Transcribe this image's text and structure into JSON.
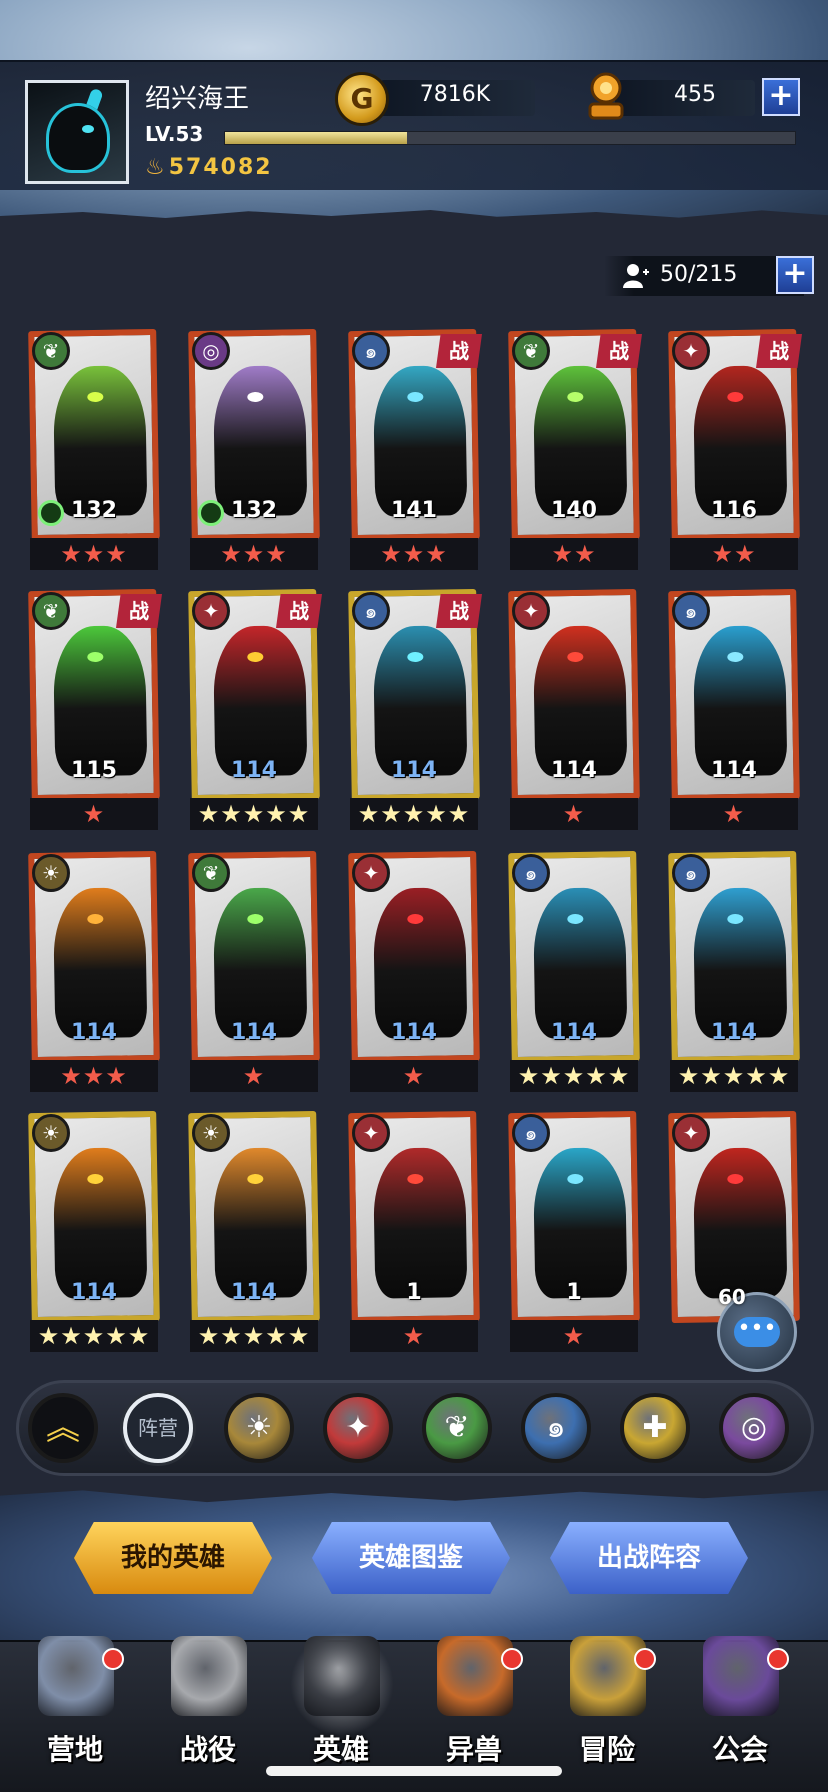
{
  "header": {
    "username": "绍兴海王",
    "level": "LV.53",
    "xp_fraction": 0.32,
    "power": "574082",
    "gold": "7816K",
    "gold_icon": "G",
    "gems": "455",
    "plus": "+"
  },
  "roster": {
    "capacity": "50/215",
    "plus": "+"
  },
  "heroes": [
    {
      "level": "132",
      "stars": "★★★",
      "star_style": "red",
      "faction_icon": "leaf-icon",
      "faction_color": "#3f7a3a",
      "battle": false,
      "clock": true,
      "level_style": "white",
      "frame": "red",
      "figure": "#79c23b",
      "eye": "#d8ff4a"
    },
    {
      "level": "132",
      "stars": "★★★",
      "star_style": "red",
      "faction_icon": "void-icon",
      "faction_color": "#6a3a86",
      "battle": false,
      "clock": true,
      "level_style": "white",
      "frame": "red",
      "figure": "#a07cc8",
      "eye": "#ffffff"
    },
    {
      "level": "141",
      "stars": "★★★",
      "star_style": "red",
      "faction_icon": "wave-icon",
      "faction_color": "#3a5f9a",
      "battle": true,
      "clock": false,
      "level_style": "white",
      "frame": "red",
      "figure": "#34a8c4",
      "eye": "#7ae6ff"
    },
    {
      "level": "140",
      "stars": "★★",
      "star_style": "red",
      "faction_icon": "leaf-icon",
      "faction_color": "#3f7a3a",
      "battle": true,
      "clock": false,
      "level_style": "white",
      "frame": "red",
      "figure": "#5ec23b",
      "eye": "#b6ff6a"
    },
    {
      "level": "116",
      "stars": "★★",
      "star_style": "red",
      "faction_icon": "flame-icon",
      "faction_color": "#9a2f35",
      "battle": true,
      "clock": false,
      "level_style": "white",
      "frame": "red",
      "figure": "#b2261f",
      "eye": "#ff3a3a"
    },
    {
      "level": "115",
      "stars": "★",
      "star_style": "red",
      "faction_icon": "leaf-icon",
      "faction_color": "#3f7a3a",
      "battle": true,
      "clock": false,
      "level_style": "white",
      "frame": "red",
      "figure": "#4cc83b",
      "eye": "#9dff6a"
    },
    {
      "level": "114",
      "stars": "★★★★★",
      "star_style": "gold",
      "faction_icon": "flame-icon",
      "faction_color": "#9a2f35",
      "battle": true,
      "clock": false,
      "level_style": "blue",
      "frame": "gold",
      "figure": "#c4262a",
      "eye": "#ffcc33"
    },
    {
      "level": "114",
      "stars": "★★★★★",
      "star_style": "gold",
      "faction_icon": "wave-icon",
      "faction_color": "#3a5f9a",
      "battle": true,
      "clock": false,
      "level_style": "blue",
      "frame": "gold",
      "figure": "#2b8fb0",
      "eye": "#6ff0ff"
    },
    {
      "level": "114",
      "stars": "★",
      "star_style": "red",
      "faction_icon": "flame-icon",
      "faction_color": "#9a2f35",
      "battle": false,
      "clock": false,
      "level_style": "white",
      "frame": "red",
      "figure": "#d0301f",
      "eye": "#ff4a3a"
    },
    {
      "level": "114",
      "stars": "★",
      "star_style": "red",
      "faction_icon": "wave-icon",
      "faction_color": "#3a5f9a",
      "battle": false,
      "clock": false,
      "level_style": "white",
      "frame": "red",
      "figure": "#2a9fcf",
      "eye": "#8ae8ff"
    },
    {
      "level": "114",
      "stars": "★★★",
      "star_style": "red",
      "faction_icon": "sun-icon",
      "faction_color": "#6b5a2a",
      "battle": false,
      "clock": false,
      "level_style": "blue",
      "frame": "red",
      "figure": "#e07d1c",
      "eye": "#ffb23a"
    },
    {
      "level": "114",
      "stars": "★",
      "star_style": "red",
      "faction_icon": "leaf-icon",
      "faction_color": "#3f7a3a",
      "battle": false,
      "clock": false,
      "level_style": "blue",
      "frame": "red",
      "figure": "#4aa84a",
      "eye": "#9dff6a"
    },
    {
      "level": "114",
      "stars": "★",
      "star_style": "red",
      "faction_icon": "flame-icon",
      "faction_color": "#9a2f35",
      "battle": false,
      "clock": false,
      "level_style": "blue",
      "frame": "red",
      "figure": "#9a1f24",
      "eye": "#ff3a3a"
    },
    {
      "level": "114",
      "stars": "★★★★★",
      "star_style": "gold",
      "faction_icon": "wave-icon",
      "faction_color": "#3a5f9a",
      "battle": false,
      "clock": false,
      "level_style": "blue",
      "frame": "gold",
      "figure": "#2a8fb6",
      "eye": "#7ae6ff"
    },
    {
      "level": "114",
      "stars": "★★★★★",
      "star_style": "gold",
      "faction_icon": "wave-icon",
      "faction_color": "#3a5f9a",
      "battle": false,
      "clock": false,
      "level_style": "blue",
      "frame": "gold",
      "figure": "#2f9fd0",
      "eye": "#7ae6ff"
    },
    {
      "level": "114",
      "stars": "★★★★★",
      "star_style": "gold",
      "faction_icon": "sun-icon",
      "faction_color": "#6b5a2a",
      "battle": false,
      "clock": false,
      "level_style": "blue",
      "frame": "gold",
      "figure": "#e07d1c",
      "eye": "#ffd23a"
    },
    {
      "level": "114",
      "stars": "★★★★★",
      "star_style": "gold",
      "faction_icon": "sun-icon",
      "faction_color": "#6b5a2a",
      "battle": false,
      "clock": false,
      "level_style": "blue",
      "frame": "gold",
      "figure": "#e0892c",
      "eye": "#ffd23a"
    },
    {
      "level": "1",
      "stars": "★",
      "star_style": "red",
      "faction_icon": "flame-icon",
      "faction_color": "#9a2f35",
      "battle": false,
      "clock": false,
      "level_style": "white",
      "frame": "red",
      "figure": "#b02a2a",
      "eye": "#ff4a3a"
    },
    {
      "level": "1",
      "stars": "★",
      "star_style": "red",
      "faction_icon": "wave-icon",
      "faction_color": "#3a5f9a",
      "battle": false,
      "clock": false,
      "level_style": "white",
      "frame": "red",
      "figure": "#2aa6c8",
      "eye": "#7ae6ff"
    },
    {
      "level": "",
      "stars": "",
      "star_style": "red",
      "faction_icon": "flame-icon",
      "faction_color": "#9a2f35",
      "battle": false,
      "clock": false,
      "level_style": "white",
      "frame": "red",
      "figure": "#c0261f",
      "eye": "#ff3a3a"
    }
  ],
  "battle_tag": "战",
  "chat": {
    "count": "60",
    "dots": "•••"
  },
  "filters": {
    "collapse_icon": "chevron-up-icon",
    "camp_label": "阵营",
    "items": [
      {
        "name": "sun-filter",
        "icon": "☀",
        "color": "#a8883a"
      },
      {
        "name": "flame-filter",
        "icon": "✦",
        "color": "#c23a3a"
      },
      {
        "name": "leaf-filter",
        "icon": "❦",
        "color": "#4a9a44"
      },
      {
        "name": "wave-filter",
        "icon": "๑",
        "color": "#3d6fb0"
      },
      {
        "name": "cross-filter",
        "icon": "✚",
        "color": "#c9a732"
      },
      {
        "name": "void-filter",
        "icon": "◎",
        "color": "#7a4a9e"
      }
    ]
  },
  "tabs": [
    {
      "label": "我的英雄",
      "active": true
    },
    {
      "label": "英雄图鉴",
      "active": false
    },
    {
      "label": "出战阵容",
      "active": false
    }
  ],
  "nav": [
    {
      "label": "营地",
      "name": "camp",
      "dot": true,
      "active": false,
      "color": "#7f8ea8"
    },
    {
      "label": "战役",
      "name": "campaign",
      "dot": false,
      "active": false,
      "color": "#a7a9ad"
    },
    {
      "label": "英雄",
      "name": "heroes",
      "dot": false,
      "active": true,
      "color": "#3a3d44"
    },
    {
      "label": "异兽",
      "name": "beasts",
      "dot": true,
      "active": false,
      "color": "#c76a2a"
    },
    {
      "label": "冒险",
      "name": "adventure",
      "dot": true,
      "active": false,
      "color": "#c9a03a"
    },
    {
      "label": "公会",
      "name": "guild",
      "dot": true,
      "active": false,
      "color": "#6a4a9a"
    }
  ],
  "colors": {
    "accent_gold": "#f3c542",
    "panel_bg": "#232836",
    "battle_red": "#b3243a"
  }
}
